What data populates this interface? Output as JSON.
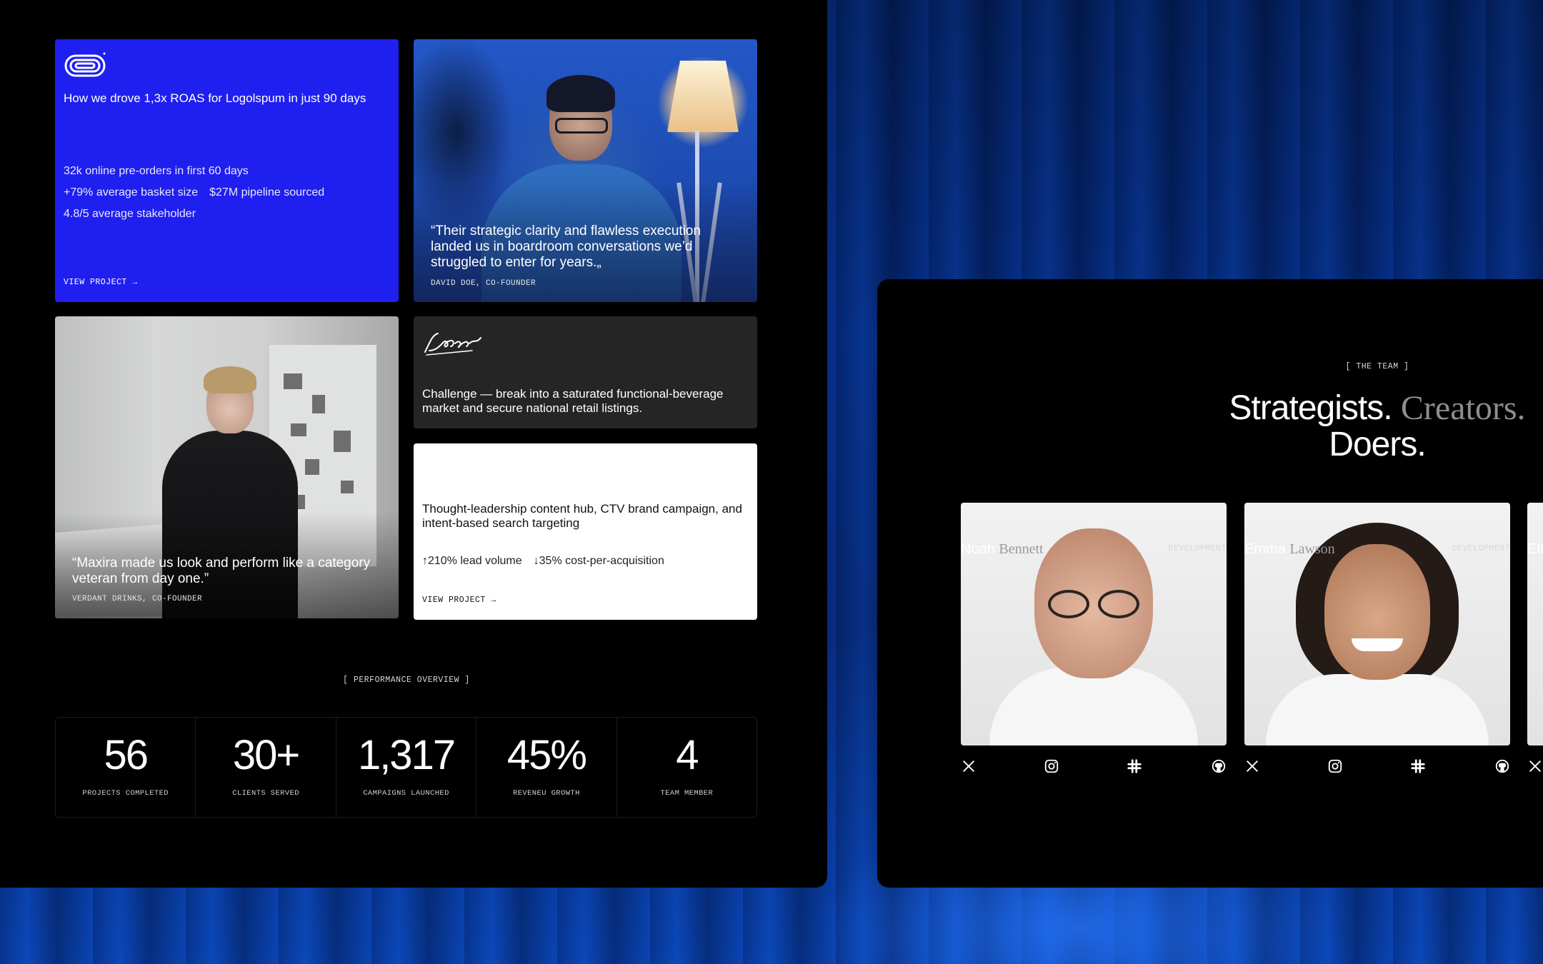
{
  "case_study_card": {
    "title": "How we drove 1,3x ROAS for Logolspum in just 90 days",
    "stats": [
      [
        "32k online pre-orders in first 60 days"
      ],
      [
        "+79% average basket size",
        "$27M pipeline sourced"
      ],
      [
        "4.8/5 average stakeholder"
      ]
    ],
    "link": "VIEW PROJECT →",
    "logo_icon": "loop-logo-icon"
  },
  "testimonial_1": {
    "quote": "“Their strategic clarity and flawless execution landed us in boardroom conversations we’d struggled to enter for years.„",
    "author": "DAVID DOE, CO-FOUNDER"
  },
  "testimonial_2": {
    "quote": "“Maxira made us look and perform like a category veteran from day one.”",
    "author": "VERDANT DRINKS, CO-FOUNDER"
  },
  "challenge_card": {
    "logo": "Logoipsum",
    "text": "Challenge — break into a saturated functional-beverage market and secure national retail listings."
  },
  "solution_card": {
    "text": "Thought-leadership content hub, CTV brand campaign, and intent-based search targeting",
    "stats": [
      "↑210% lead volume",
      "↓35% cost-per-acquisition"
    ],
    "link": "VIEW PROJECT →"
  },
  "performance": {
    "label": "[ PERFORMANCE OVERVIEW ]",
    "stats": [
      {
        "value": "56",
        "label": "PROJECTS COMPLETED"
      },
      {
        "value": "30+",
        "label": "CLIENTS SERVED"
      },
      {
        "value": "1,317",
        "label": "CAMPAIGNS LAUNCHED"
      },
      {
        "value": "45%",
        "label": "REVENEU GROWTH"
      },
      {
        "value": "4",
        "label": "TEAM MEMBER"
      }
    ]
  },
  "team": {
    "label": "[ THE TEAM ]",
    "title_part1": "Strategists.",
    "title_part2": "Creators.",
    "title_part3": "Doers.",
    "members": [
      {
        "first": "Noah",
        "last": "Bennett",
        "role": "DEVELOPMENT"
      },
      {
        "first": "Emma",
        "last": "Lawson",
        "role": "DEVELOPMENT"
      },
      {
        "first": "Eth",
        "last": "",
        "role": ""
      }
    ],
    "social_icons": [
      "x-icon",
      "instagram-icon",
      "slack-icon",
      "github-icon"
    ]
  },
  "colors": {
    "accent_blue": "#1f1ff0",
    "background": "#000000",
    "card_dark": "#252525"
  }
}
